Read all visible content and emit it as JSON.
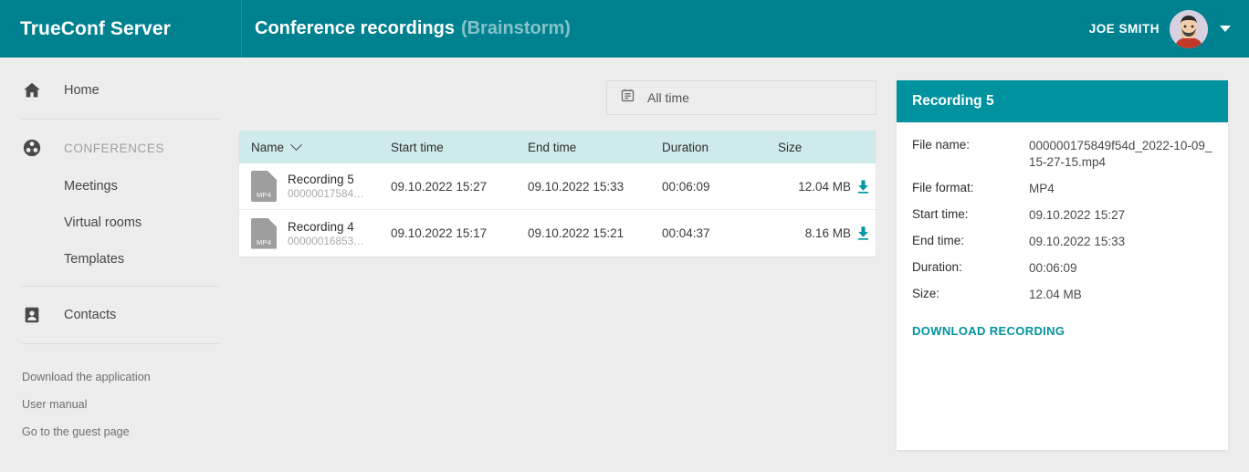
{
  "header": {
    "logo": "TrueConf Server",
    "title": "Conference recordings",
    "subtitle": "(Brainstorm)",
    "username": "JOE SMITH"
  },
  "sidebar": {
    "items": [
      {
        "label": "Home",
        "icon": "home-icon"
      },
      {
        "label": "CONFERENCES",
        "icon": "conferences-icon"
      },
      {
        "label": "Contacts",
        "icon": "contacts-icon"
      }
    ],
    "sub_items": [
      {
        "label": "Meetings"
      },
      {
        "label": "Virtual rooms"
      },
      {
        "label": "Templates"
      }
    ],
    "links": [
      {
        "label": "Download the application"
      },
      {
        "label": "User manual"
      },
      {
        "label": "Go to the guest page"
      }
    ]
  },
  "filter": {
    "icon": "calendar-icon",
    "label": "All time"
  },
  "table": {
    "columns": {
      "name": "Name",
      "start_time": "Start time",
      "end_time": "End time",
      "duration": "Duration",
      "size": "Size"
    },
    "rows": [
      {
        "name": "Recording 5",
        "file_id": "00000017584…",
        "ext": "MP4",
        "start_time": "09.10.2022 15:27",
        "end_time": "09.10.2022 15:33",
        "duration": "00:06:09",
        "size": "12.04 MB"
      },
      {
        "name": "Recording 4",
        "file_id": "00000016853…",
        "ext": "MP4",
        "start_time": "09.10.2022 15:17",
        "end_time": "09.10.2022 15:21",
        "duration": "00:04:37",
        "size": "8.16 MB"
      }
    ]
  },
  "panel": {
    "title": "Recording 5",
    "fields": [
      {
        "label": "File name:",
        "value": "000000175849f54d_2022-10-09_15-27-15.mp4"
      },
      {
        "label": "File format:",
        "value": "MP4"
      },
      {
        "label": "Start time:",
        "value": "09.10.2022 15:27"
      },
      {
        "label": "End time:",
        "value": "09.10.2022 15:33"
      },
      {
        "label": "Duration:",
        "value": "00:06:09"
      },
      {
        "label": "Size:",
        "value": "12.04 MB"
      }
    ],
    "download_label": "DOWNLOAD RECORDING"
  },
  "colors": {
    "header_teal": "#00818f",
    "panel_teal": "#00939f",
    "accent_teal": "#00939f",
    "table_header": "#cfeaea",
    "page_bg": "#ededed"
  }
}
